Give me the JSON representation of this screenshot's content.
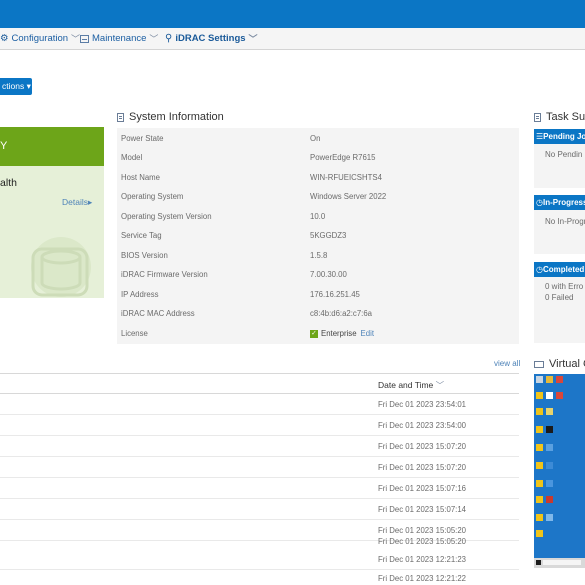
{
  "nav": {
    "configuration": "Configuration",
    "maintenance": "Maintenance",
    "idrac_settings": "iDRAC Settings"
  },
  "actions_button": "ctions",
  "health": {
    "status": "Y",
    "label": "alth",
    "details_link": "Details"
  },
  "system_information": {
    "title": "System Information",
    "rows": [
      {
        "label": "Power State",
        "value": "On"
      },
      {
        "label": "Model",
        "value": "PowerEdge R7615"
      },
      {
        "label": "Host Name",
        "value": "WIN-RFUEICSHTS4"
      },
      {
        "label": "Operating System",
        "value": "Windows Server 2022"
      },
      {
        "label": "Operating System Version",
        "value": "10.0"
      },
      {
        "label": "Service Tag",
        "value": "5KGGDZ3"
      },
      {
        "label": "BIOS Version",
        "value": "1.5.8"
      },
      {
        "label": "iDRAC Firmware Version",
        "value": "7.00.30.00"
      },
      {
        "label": "IP Address",
        "value": "176.16.251.45"
      },
      {
        "label": "iDRAC MAC Address",
        "value": "c8:4b:d6:a2:c7:6a"
      },
      {
        "label": "License",
        "value": "Enterprise",
        "action": "Edit"
      }
    ]
  },
  "logs": {
    "view_all": "view all",
    "date_header": "Date and Time",
    "times": [
      "Fri Dec 01 2023 23:54:01",
      "Fri Dec 01 2023 23:54:00",
      "Fri Dec 01 2023 15:07:20",
      "Fri Dec 01 2023 15:07:20",
      "Fri Dec 01 2023 15:07:16",
      "Fri Dec 01 2023 15:07:14",
      "Fri Dec 01 2023 15:05:20",
      "Fri Dec 01 2023 15:05:20",
      "Fri Dec 01 2023 12:21:23",
      "Fri Dec 01 2023 12:21:22"
    ]
  },
  "task_summary": {
    "title": "Task Su",
    "pending_header": "Pending Jo",
    "pending_text": "No Pendin",
    "inprogress_header": "In-Progress",
    "inprogress_text": "No In-Progr",
    "completed_header": "Completed",
    "completed_errors": "0 with Erro",
    "completed_failed": "0 Failed"
  },
  "virtual_console": {
    "title": "Virtual C"
  },
  "colors": {
    "brand_blue": "#0b76c5",
    "health_green": "#6da519",
    "health_bg": "#e6f0d8",
    "link": "#4e83b8"
  }
}
